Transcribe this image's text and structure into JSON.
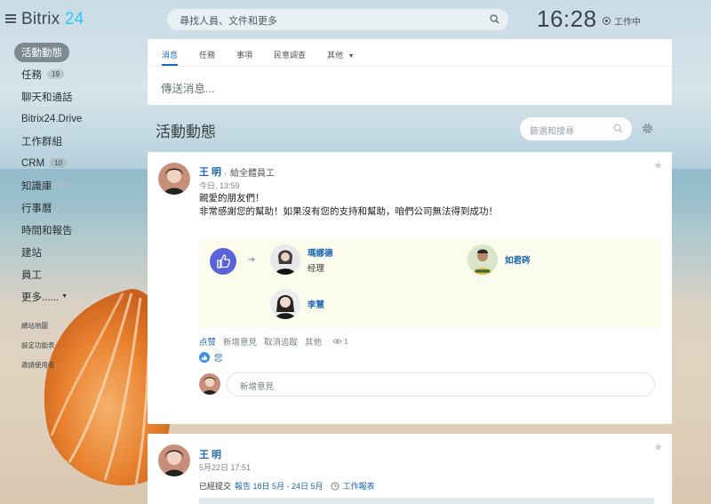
{
  "header": {
    "logo_name": "Bitrix",
    "logo_num": "24",
    "search_placeholder": "尋找人員、文件和更多",
    "clock": "16:28",
    "status": "工作中"
  },
  "leftmenu": {
    "items": [
      {
        "label": "活動動態",
        "active": true
      },
      {
        "label": "任務",
        "badge": "19"
      },
      {
        "label": "聊天和通話"
      },
      {
        "label": "Bitrix24.Drive"
      },
      {
        "label": "工作群組"
      },
      {
        "label": "CRM",
        "badge": "10"
      },
      {
        "label": "知識庫",
        "beta": "beta"
      },
      {
        "label": "行事曆"
      },
      {
        "label": "時間和報告"
      },
      {
        "label": "建站"
      },
      {
        "label": "員工"
      },
      {
        "label": "更多......"
      }
    ],
    "small_links": [
      "網站地圖",
      "設定功能表",
      "邀請使用者"
    ]
  },
  "composer": {
    "tabs": [
      "消息",
      "任務",
      "事項",
      "民意調查",
      "其他"
    ],
    "placeholder": "傳送消息..."
  },
  "feed": {
    "title": "活動動態",
    "filter_placeholder": "篩選和搜尋"
  },
  "post1": {
    "author": "王 明",
    "destination": "給全體員工",
    "date": "今日, 13:59",
    "line1": "親愛的朋友們！",
    "line2": "非常感謝您的幫助！如果沒有您的支持和幫助，咱們公司無法得到成功！",
    "people": [
      {
        "name": "瑪娜德",
        "role": "经理"
      },
      {
        "name": "如君硶",
        "role": ""
      },
      {
        "name": "李慧",
        "role": ""
      }
    ],
    "actions": [
      "点赞",
      "新增意見",
      "取消追蹤",
      "其他"
    ],
    "views": "1",
    "liked_by": "您",
    "comment_placeholder": "新增意見"
  },
  "post2": {
    "author": "王 明",
    "date": "5月22日 17:51",
    "report_prefix": "已經提交",
    "report_link": "報告 18日 5月 - 24日 5月",
    "report_type": "工作報表"
  }
}
